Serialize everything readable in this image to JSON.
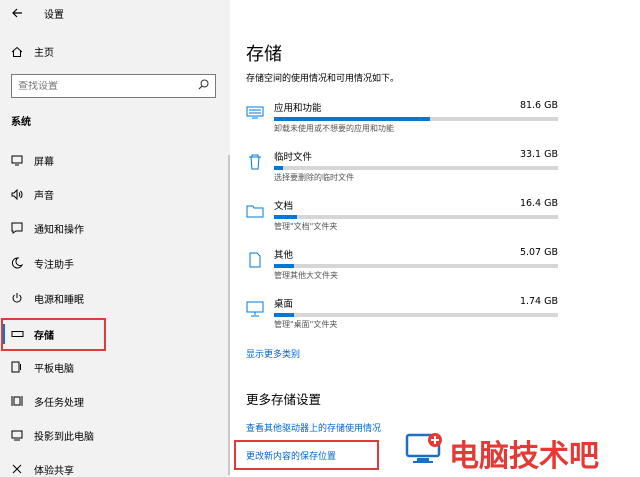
{
  "window": {
    "title": "设置"
  },
  "sidebar": {
    "home_label": "主页",
    "search_placeholder": "查找设置",
    "section_label": "系统",
    "items": [
      {
        "label": "屏幕",
        "icon": "monitor-icon"
      },
      {
        "label": "声音",
        "icon": "speaker-icon"
      },
      {
        "label": "通知和操作",
        "icon": "notification-icon"
      },
      {
        "label": "专注助手",
        "icon": "moon-icon"
      },
      {
        "label": "电源和睡眠",
        "icon": "power-icon"
      },
      {
        "label": "存储",
        "icon": "storage-icon",
        "active": true
      },
      {
        "label": "平板电脑",
        "icon": "tablet-icon"
      },
      {
        "label": "多任务处理",
        "icon": "multitask-icon"
      },
      {
        "label": "投影到此电脑",
        "icon": "project-icon"
      },
      {
        "label": "体验共享",
        "icon": "share-icon"
      }
    ]
  },
  "main": {
    "title": "存储",
    "description": "存储空间的使用情况和可用情况如下。",
    "categories": [
      {
        "name": "应用和功能",
        "size": "81.6 GB",
        "desc": "卸载未使用或不想要的应用和功能",
        "usage_fraction": 0.55,
        "icon": "apps-icon"
      },
      {
        "name": "临时文件",
        "size": "33.1 GB",
        "desc": "选择要删除的临时文件",
        "usage_fraction": 0.03,
        "icon": "trash-icon"
      },
      {
        "name": "文档",
        "size": "16.4 GB",
        "desc": "管理\"文档\"文件夹",
        "usage_fraction": 0.08,
        "icon": "folder-icon"
      },
      {
        "name": "其他",
        "size": "5.07 GB",
        "desc": "管理其他大文件夹",
        "usage_fraction": 0.07,
        "icon": "file-icon"
      },
      {
        "name": "桌面",
        "size": "1.74 GB",
        "desc": "管理\"桌面\"文件夹",
        "usage_fraction": 0.07,
        "icon": "desktop-icon"
      }
    ],
    "show_more": "显示更多类别",
    "more_title": "更多存储设置",
    "link_other_drives": "查看其他驱动器上的存储使用情况",
    "link_save_location": "更改新内容的保存位置"
  },
  "watermark": {
    "brand": "电脑技术吧"
  },
  "colors": {
    "accent": "#0078d7",
    "highlight_box": "#e03a3a",
    "link": "#0066cc"
  }
}
